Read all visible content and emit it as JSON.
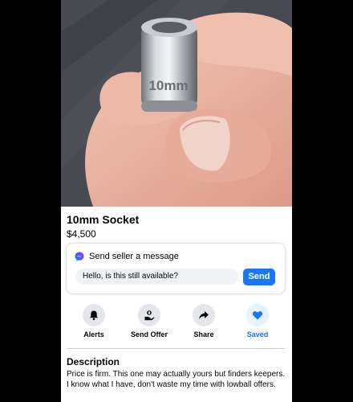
{
  "listing": {
    "title": "10mm Socket",
    "price": "$4,500",
    "image_alt": "hand holding a 10mm socket",
    "socket_marking": "10mm"
  },
  "message_card": {
    "heading": "Send seller a message",
    "input_value": "Hello, is this still available?",
    "send_label": "Send",
    "icon": "messenger-icon"
  },
  "actions": [
    {
      "label": "Alerts",
      "icon": "bell-icon"
    },
    {
      "label": "Send Offer",
      "icon": "offer-icon"
    },
    {
      "label": "Share",
      "icon": "share-icon"
    },
    {
      "label": "Saved",
      "icon": "heart-icon"
    }
  ],
  "description": {
    "heading": "Description",
    "text": "Price is firm. This one may actually yours but finders keepers.\nI know what I have, don't waste my time with lowball offers."
  },
  "colors": {
    "accent": "#1877f2",
    "icon_bg": "#e4e6eb",
    "input_bg": "#f0f2f5"
  }
}
